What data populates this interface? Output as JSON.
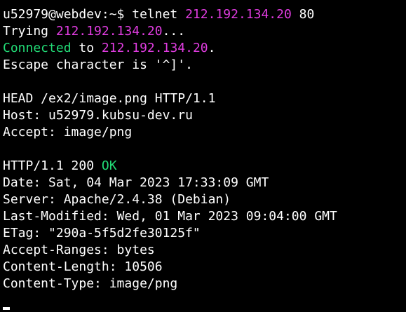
{
  "terminal": {
    "colors": {
      "background": "#000000",
      "text": "#ffffff",
      "highlight_ip": "#e03ce0",
      "highlight_status": "#22dd77"
    },
    "command_line": {
      "prompt": "u52979@webdev:~$ ",
      "command": "telnet ",
      "host": "212.192.134.20",
      "port": " 80"
    },
    "trying_line": {
      "prefix": "Trying ",
      "ip": "212.192.134.20",
      "suffix": "..."
    },
    "connected_line": {
      "status": "Connected",
      "middle": " to ",
      "ip": "212.192.134.20",
      "suffix": "."
    },
    "escape_line": "Escape character is '^]'.",
    "request": {
      "request_line": "HEAD /ex2/image.png HTTP/1.1",
      "host_header": "Host: u52979.kubsu-dev.ru",
      "accept_header": "Accept: image/png"
    },
    "response": {
      "status_prefix": "HTTP/1.1 200 ",
      "status_text": "OK",
      "headers": [
        "Date: Sat, 04 Mar 2023 17:33:09 GMT",
        "Server: Apache/2.4.38 (Debian)",
        "Last-Modified: Wed, 01 Mar 2023 09:04:00 GMT",
        "ETag: \"290a-5f5d2fe30125f\"",
        "Accept-Ranges: bytes",
        "Content-Length: 10506",
        "Content-Type: image/png"
      ]
    }
  }
}
